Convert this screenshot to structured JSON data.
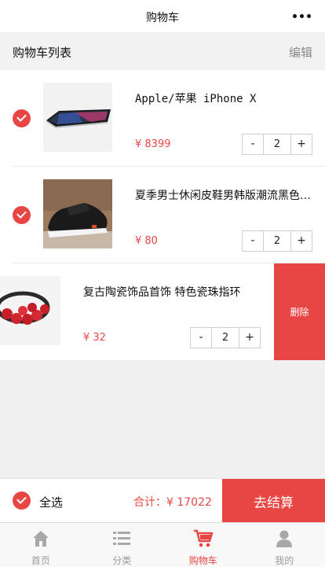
{
  "nav": {
    "title": "购物车",
    "more_icon": "more-dots-icon"
  },
  "list_header": {
    "title": "购物车列表",
    "edit_label": "编辑"
  },
  "items": [
    {
      "name": "Apple/苹果 iPhone X",
      "price": "¥ 8399",
      "quantity": "2",
      "checked": true,
      "image_icon": "iphone-image"
    },
    {
      "name": "夏季男士休闲皮鞋男韩版潮流黑色英伦",
      "price": "¥ 80",
      "quantity": "2",
      "checked": true,
      "image_icon": "shoe-image"
    },
    {
      "name": "复古陶瓷饰品首饰 特色瓷珠指环",
      "price": "¥ 32",
      "quantity": "2",
      "checked": true,
      "image_icon": "bead-ring-image"
    }
  ],
  "stepper": {
    "minus": "-",
    "plus": "+"
  },
  "delete_label": "删除",
  "footer": {
    "select_all_label": "全选",
    "total_label": "合计：¥ 17022",
    "checkout_label": "去结算"
  },
  "tabbar": [
    {
      "label": "首页",
      "icon": "home-icon",
      "active": false
    },
    {
      "label": "分类",
      "icon": "list-icon",
      "active": false
    },
    {
      "label": "购物车",
      "icon": "cart-icon",
      "active": true
    },
    {
      "label": "我的",
      "icon": "user-icon",
      "active": false
    }
  ],
  "colors": {
    "accent": "#e84545",
    "muted": "#9a9a9a",
    "background": "#f0f0f0"
  }
}
